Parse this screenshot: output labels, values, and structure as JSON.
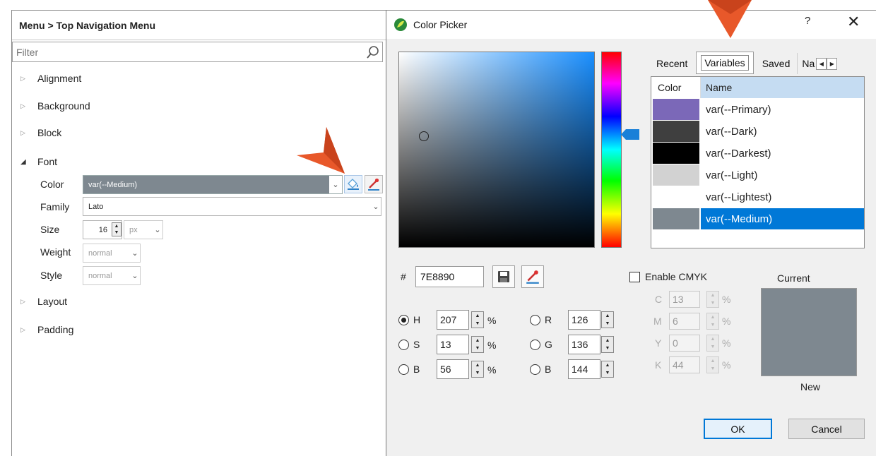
{
  "left_panel": {
    "header": "Menu > Top Navigation Menu",
    "filter_placeholder": "Filter",
    "groups": {
      "alignment": "Alignment",
      "background": "Background",
      "block": "Block",
      "font": "Font",
      "layout": "Layout",
      "padding": "Padding"
    },
    "font_props": {
      "color_label": "Color",
      "color_value": "var(--Medium)",
      "family_label": "Family",
      "family_value": "Lato",
      "size_label": "Size",
      "size_value": "16",
      "size_unit": "px",
      "weight_label": "Weight",
      "weight_value": "normal",
      "style_label": "Style",
      "style_value": "normal"
    }
  },
  "dialog": {
    "title": "Color Picker",
    "help": "?",
    "close": "✕",
    "tabs": [
      "Recent",
      "Variables",
      "Saved",
      "Na"
    ],
    "table_headers": {
      "color": "Color",
      "name": "Name"
    },
    "variables": [
      {
        "name": "var(--Primary)",
        "color": "#7b68b8"
      },
      {
        "name": "var(--Dark)",
        "color": "#3f3f3f"
      },
      {
        "name": "var(--Darkest)",
        "color": "#000000"
      },
      {
        "name": "var(--Light)",
        "color": "#d2d2d2"
      },
      {
        "name": "var(--Lightest)",
        "color": "#ffffff"
      },
      {
        "name": "var(--Medium)",
        "color": "#7e8890",
        "selected": true
      }
    ],
    "hex_label": "#",
    "hex_value": "7E8890",
    "hsb": {
      "h_label": "H",
      "h_value": "207",
      "h_unit": "%",
      "s_label": "S",
      "s_value": "13",
      "s_unit": "%",
      "b_label": "B",
      "b_value": "56",
      "b_unit": "%"
    },
    "rgb": {
      "r_label": "R",
      "r_value": "126",
      "g_label": "G",
      "g_value": "136",
      "b_label": "B",
      "b_value": "144"
    },
    "cmyk": {
      "enable_label": "Enable CMYK",
      "c_label": "C",
      "c_value": "13",
      "m_label": "M",
      "m_value": "6",
      "y_label": "Y",
      "y_value": "0",
      "k_label": "K",
      "k_value": "44",
      "unit": "%"
    },
    "current_label": "Current",
    "new_label": "New",
    "current_color": "#7e8890",
    "ok_label": "OK",
    "cancel_label": "Cancel"
  },
  "accent_color": "#e8582a"
}
